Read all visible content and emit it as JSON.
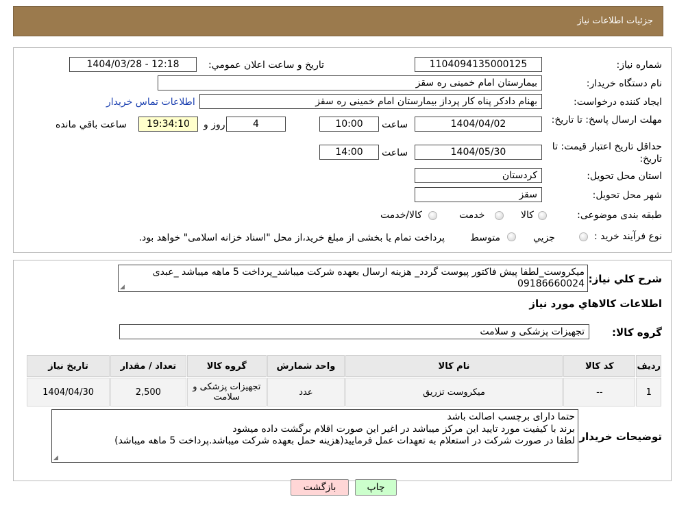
{
  "header": {
    "title": "جزئیات اطلاعات نیاز"
  },
  "form": {
    "need_number_label": "شماره نیاز:",
    "need_number": "1104094135000125",
    "announce_label": "تاریخ و ساعت اعلان عمومي:",
    "announce_value": "1404/03/28 - 12:18",
    "buyer_org_label": "نام دستگاه خریدار:",
    "buyer_org": "بیمارستان امام خمینی  ره  سقز",
    "creator_label": "ایجاد کننده درخواست:",
    "creator": "بهنام دادکر پناه کار پرداز بیمارستان امام خمینی  ره  سقز",
    "contact_link": "اطلاعات تماس خریدار",
    "deadline_label": "مهلت ارسال پاسخ: تا تاریخ:",
    "deadline_date": "1404/04/02",
    "time_label": "ساعت",
    "deadline_time": "10:00",
    "days_value": "4",
    "days_label": "روز و",
    "remaining_time": "19:34:10",
    "remaining_label": "ساعت باقي مانده",
    "validity_label": "حداقل تاریخ اعتبار قیمت: تا تاریخ:",
    "validity_date": "1404/05/30",
    "validity_time": "14:00",
    "province_label": "استان محل تحویل:",
    "province": "کردستان",
    "city_label": "شهر محل تحویل:",
    "city": "سقز",
    "category_label": "طبقه بندی موضوعی:",
    "category_options": [
      "کالا",
      "خدمت",
      "کالا/خدمت"
    ],
    "process_label": "نوع فرآیند خرید :",
    "process_options": [
      "جزيي",
      "متوسط"
    ],
    "process_note": "پرداخت تمام یا بخشی از مبلغ خرید،از محل \"اسناد خزانه اسلامی\" خواهد بود."
  },
  "details": {
    "summary_label": "شرح کلي نیاز:",
    "summary_line1": "میکروست_لطفا پیش فاکتور پیوست گردد_ هزینه ارسال بعهده شرکت میباشد_پرداخت 5 ماهه میباشد _عبدی",
    "summary_line2": "09186660024",
    "goods_info_title": "اطلاعات کالاهاي مورد نیاز",
    "group_label": "گروه کالا:",
    "group_value": "تجهیزات پزشکی و سلامت",
    "table_headers": [
      "ردیف",
      "کد کالا",
      "نام کالا",
      "واحد شمارش",
      "گروه کالا",
      "تعداد / مقدار",
      "تاریخ نیاز"
    ],
    "rows": [
      {
        "row": "1",
        "code": "--",
        "name": "میکروست تزریق",
        "unit": "عدد",
        "group": "تجهیزات پزشکی و سلامت",
        "qty": "2,500",
        "date": "1404/04/30"
      }
    ],
    "buyer_notes_label": "توضیحات خریدار:",
    "notes_lines": [
      "حتما دارای برچسب اصالت باشد",
      "برند با کیفیت مورد تایید این مرکز میباشد در اغیر این صورت اقلام برگشت داده میشود",
      "لطفا در صورت شرکت در استعلام به تعهدات عمل فرمایید(هزینه حمل بعهده شرکت میباشد.پرداخت 5 ماهه میباشد)"
    ]
  },
  "buttons": {
    "print": "چاپ",
    "back": "بازگشت"
  },
  "colors": {
    "header": "#9b7a4d",
    "print_bg": "#ccffcc",
    "back_bg": "#ffd6d6",
    "countdown_bg": "#ffffcc",
    "link": "#1a3fb0"
  }
}
